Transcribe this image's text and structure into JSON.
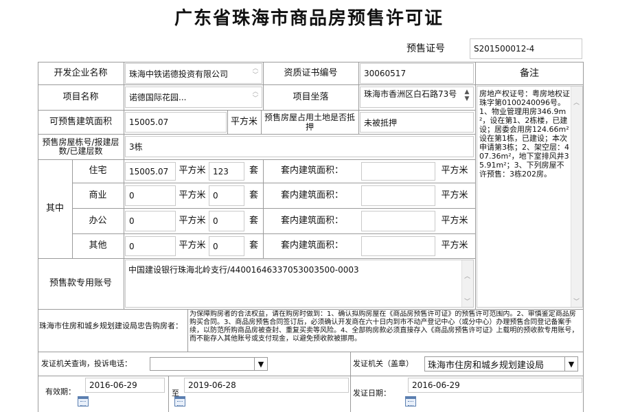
{
  "title": "广东省珠海市商品房预售许可证",
  "permit_no": {
    "label": "预售证号",
    "value": "S201500012-4"
  },
  "developer": {
    "label": "开发企业名称",
    "value": "珠海中铁诺德投资有限公司"
  },
  "cert": {
    "label": "资质证书编号",
    "value": "30060517"
  },
  "remarks": {
    "label": "备注",
    "value": "房地产权证号：粤房地权证珠字第0100240096号。1、物业管理用房346.9m²，设在第1、2栋楼，已建设；居委会用房124.66m²设在第1栋，已建设；本次申请第3栋；2、架空层：407.36m²，地下室排风井35.91m²；3、下列房屋不许预售：3栋202房。"
  },
  "project": {
    "label": "项目名称",
    "value": "诺德国际花园..."
  },
  "location": {
    "label": "项目坐落",
    "value": "珠海市香洲区白石路73号"
  },
  "presale_area": {
    "label": "可预售建筑面积",
    "value": "15005.07",
    "unit": "平方米"
  },
  "mortgage": {
    "label": "预售房屋占用土地是否抵押",
    "value": "未被抵押"
  },
  "buildings": {
    "label": "预售房屋栋号/报建层数/已建层数",
    "value": "3栋"
  },
  "breakdown": {
    "label": "其中",
    "area_unit": "平方米",
    "count_unit": "套",
    "inner_label": "套内建筑面积：",
    "inner_unit": "平方米",
    "rows": [
      {
        "name": "住宅",
        "area": "15005.07",
        "count": "123",
        "inner": ""
      },
      {
        "name": "商业",
        "area": "0",
        "count": "0",
        "inner": ""
      },
      {
        "name": "办公",
        "area": "0",
        "count": "0",
        "inner": ""
      },
      {
        "name": "其他",
        "area": "0",
        "count": "0",
        "inner": ""
      }
    ]
  },
  "account": {
    "label": "预售款专用账号",
    "value": "中国建设银行珠海北岭支行/44001646337053003500-0003"
  },
  "notice": {
    "label": "珠海市住房和城乡规划建设局忠告购房者：",
    "text": "为保障购房者的合法权益，请在购房时做到：1、确认拟购房屋在《商品房预售许可证》的预售许可范围内。2、审慎鉴定商品房购买合同。3、商品房预售合同签订后，必须确认开发商在六十日内到市不动产登记中心（或分中心）办理预售合同登记备案手续，以防范所购商品房被查封、重复买卖等风险。4、全部购房款必须直接存入《商品房预售许可证》上载明的预收款专用账号，而不能存入其他账号或支付现金，以避免预收款被挪用。"
  },
  "hotline": {
    "label": "发证机关查询，投诉电话：",
    "value": ""
  },
  "issuer": {
    "label": "发证机关（盖章）",
    "value": "珠海市住房和城乡规划建设局"
  },
  "validity": {
    "label": "有效期：",
    "from": "2016-06-29",
    "to_label": "至",
    "to": "2019-06-28"
  },
  "issue_date": {
    "label": "发证日期：",
    "value": "2016-06-29"
  }
}
